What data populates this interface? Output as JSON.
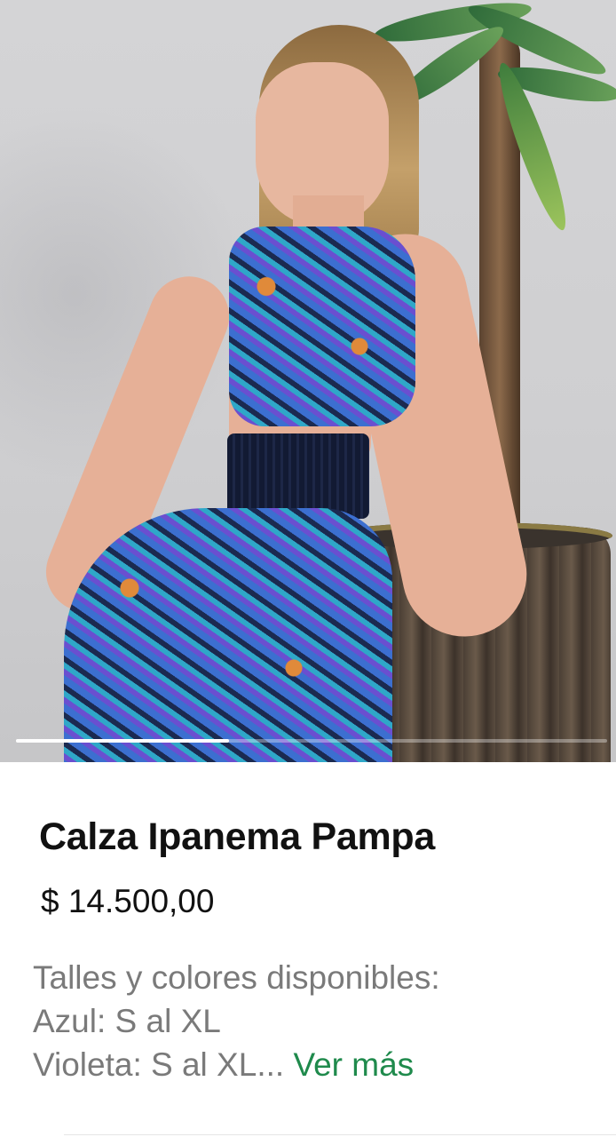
{
  "product": {
    "name": "Calza Ipanema Pampa",
    "price": "$ 14.500,00",
    "description_lines": [
      "Talles y colores disponibles:",
      "Azul: S al XL",
      "Violeta: S al XL..."
    ],
    "more_label": "Ver más"
  },
  "gallery": {
    "image_alt": "product-photo",
    "progress": 0.36
  },
  "colors": {
    "title": "#111111",
    "description": "#7a7a7a",
    "link": "#1f8a4c"
  }
}
